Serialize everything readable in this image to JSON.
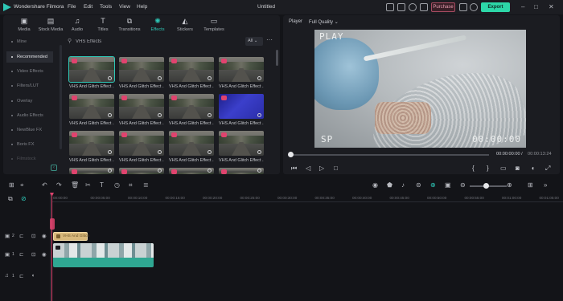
{
  "app": {
    "name": "Wondershare Filmora",
    "document_title": "Untitled"
  },
  "menu": [
    "File",
    "Edit",
    "Tools",
    "View",
    "Help"
  ],
  "titlebar": {
    "purchase_label": "Purchase",
    "export_label": "Export"
  },
  "tabs": [
    {
      "label": "Media",
      "icon": "media-icon"
    },
    {
      "label": "Stock Media",
      "icon": "stock-media-icon"
    },
    {
      "label": "Audio",
      "icon": "audio-icon"
    },
    {
      "label": "Titles",
      "icon": "titles-icon"
    },
    {
      "label": "Transitions",
      "icon": "transitions-icon"
    },
    {
      "label": "Effects",
      "icon": "effects-icon",
      "active": true
    },
    {
      "label": "Stickers",
      "icon": "stickers-icon"
    },
    {
      "label": "Templates",
      "icon": "templates-icon"
    }
  ],
  "sidebar": {
    "items": [
      {
        "label": "Mine"
      },
      {
        "label": "Recommended",
        "active": true
      },
      {
        "label": "Video Effects"
      },
      {
        "label": "Filters/LUT"
      },
      {
        "label": "Overlay"
      },
      {
        "label": "Audio Effects"
      },
      {
        "label": "NewBlue FX"
      },
      {
        "label": "Boris FX"
      },
      {
        "label": "Filmstock"
      }
    ]
  },
  "search": {
    "value": "VHS Effects",
    "filter": "All"
  },
  "effects_grid": {
    "card_label": "VHS And Glitch Effect ...",
    "rows": 4,
    "cols": 4,
    "blue_card_index": 7,
    "selected_card_index": 0
  },
  "player": {
    "label": "Player",
    "quality": "Full Quality",
    "osd_top_left": "PLAY",
    "osd_bottom_left": "SP",
    "osd_bottom_right": "00:00:00",
    "timecode_current": "00:00:00:00",
    "timecode_separator": "/",
    "timecode_total": "00:00:13:24",
    "progress": 0.0
  },
  "timeline": {
    "ruler_ticks": [
      "00:00:00",
      "00:00:05:00",
      "00:00:10:00",
      "00:00:15:00",
      "00:00:20:00",
      "00:00:25:00",
      "00:00:30:00",
      "00:00:35:00",
      "00:00:40:00",
      "00:00:45:00",
      "00:00:50:00",
      "00:00:55:00",
      "00:01:00:00",
      "00:01:05:00"
    ],
    "effect_clip_label": "VHS And Glitch",
    "video_clip_label": "",
    "tracks": [
      {
        "number": "2",
        "type": "effect"
      },
      {
        "number": "1",
        "type": "video"
      },
      {
        "number": "1",
        "type": "audio"
      }
    ],
    "zoom_level": 0.35
  },
  "colors": {
    "accent": "#2ec7b6",
    "playhead": "#e0436e",
    "export": "#2dd7a8",
    "effect_clip": "#d9b97b",
    "video_clip": "#2fa792"
  }
}
